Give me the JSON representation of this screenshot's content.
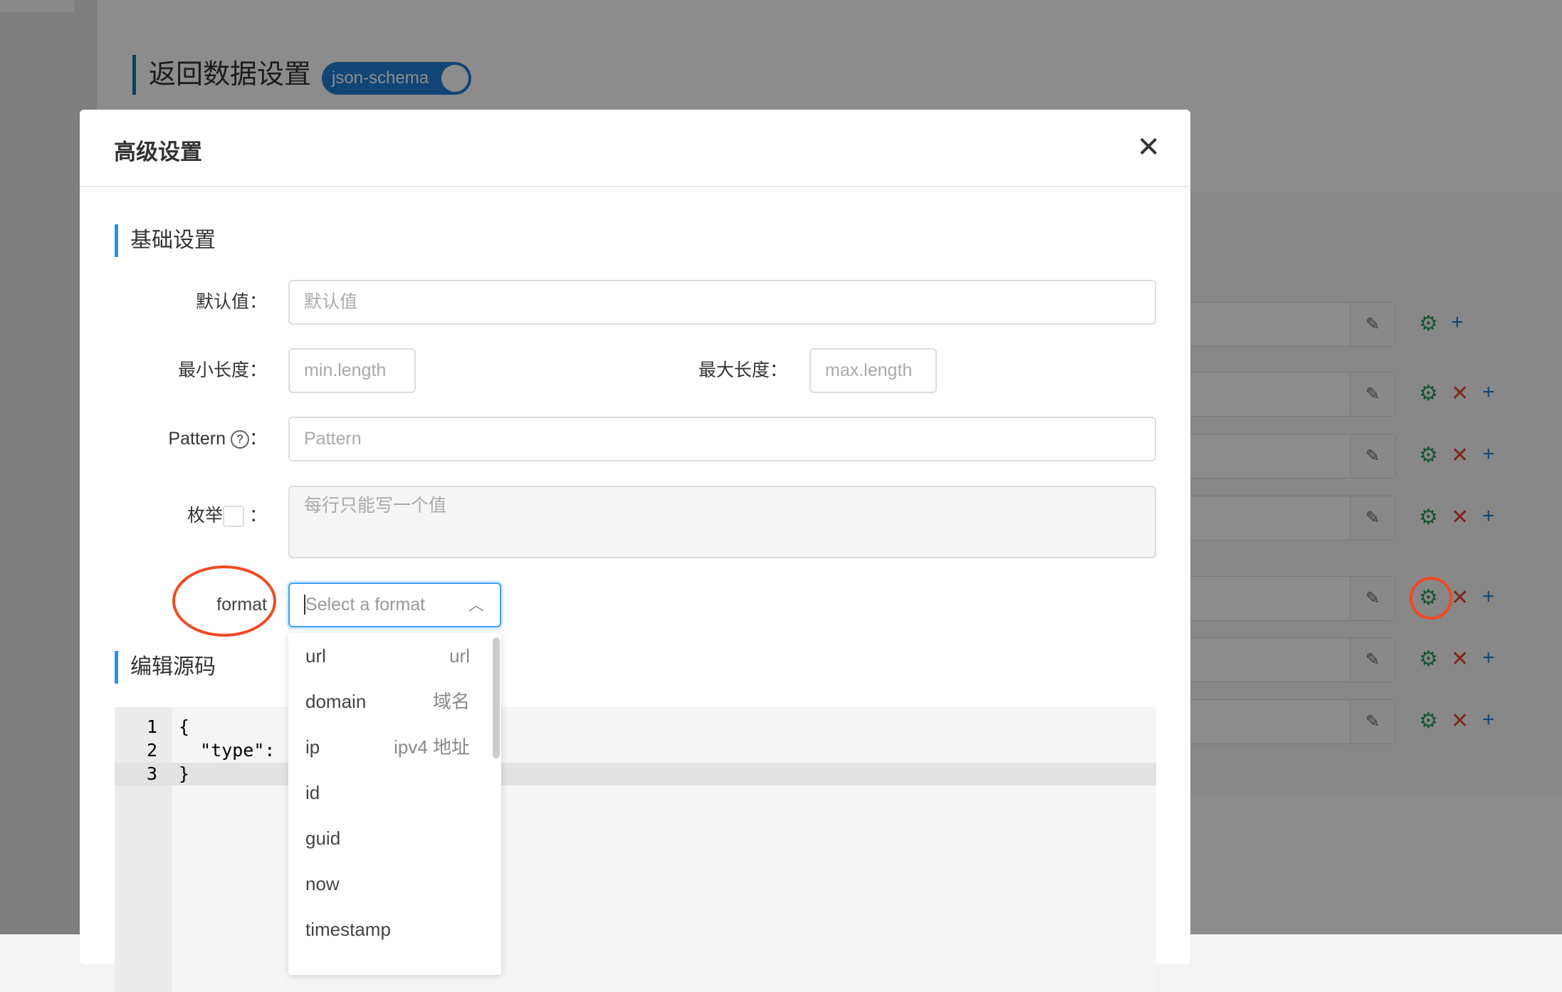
{
  "background": {
    "section_title": "返回数据设置",
    "toggle_label": "json-schema",
    "rows": [
      {
        "has_delete": false
      },
      {
        "has_delete": true
      },
      {
        "has_delete": true
      },
      {
        "has_delete": true
      },
      {
        "has_delete": true,
        "highlighted": true
      },
      {
        "has_delete": true
      },
      {
        "has_delete": true
      }
    ]
  },
  "modal": {
    "title": "高级设置",
    "close_icon": "close-icon",
    "basic_section": "基础设置",
    "default_label": "默认值：",
    "default_placeholder": "默认值",
    "min_label": "最小长度：",
    "min_placeholder": "min.length",
    "max_label": "最大长度：",
    "max_placeholder": "max.length",
    "pattern_label": "Pattern",
    "pattern_colon": "：",
    "pattern_placeholder": "Pattern",
    "enum_label": "枚举",
    "enum_colon": "：",
    "enum_placeholder": "每行只能写一个值",
    "format_label": "format",
    "format_placeholder": "Select a format",
    "source_section": "编辑源码",
    "code_lines": [
      {
        "num": "1",
        "text": "{"
      },
      {
        "num": "2",
        "text": "  \"type\": \""
      },
      {
        "num": "3",
        "text": "}"
      }
    ],
    "format_options": [
      {
        "value": "url",
        "desc": "url"
      },
      {
        "value": "domain",
        "desc": "域名"
      },
      {
        "value": "ip",
        "desc": "ipv4 地址"
      },
      {
        "value": "id",
        "desc": ""
      },
      {
        "value": "guid",
        "desc": ""
      },
      {
        "value": "now",
        "desc": ""
      },
      {
        "value": "timestamp",
        "desc": ""
      }
    ]
  },
  "colors": {
    "accent": "#2b8fe6",
    "annotation": "#f04a24",
    "gear": "#2e9e5b",
    "delete": "#e04a2a",
    "add": "#2b7fd6"
  }
}
